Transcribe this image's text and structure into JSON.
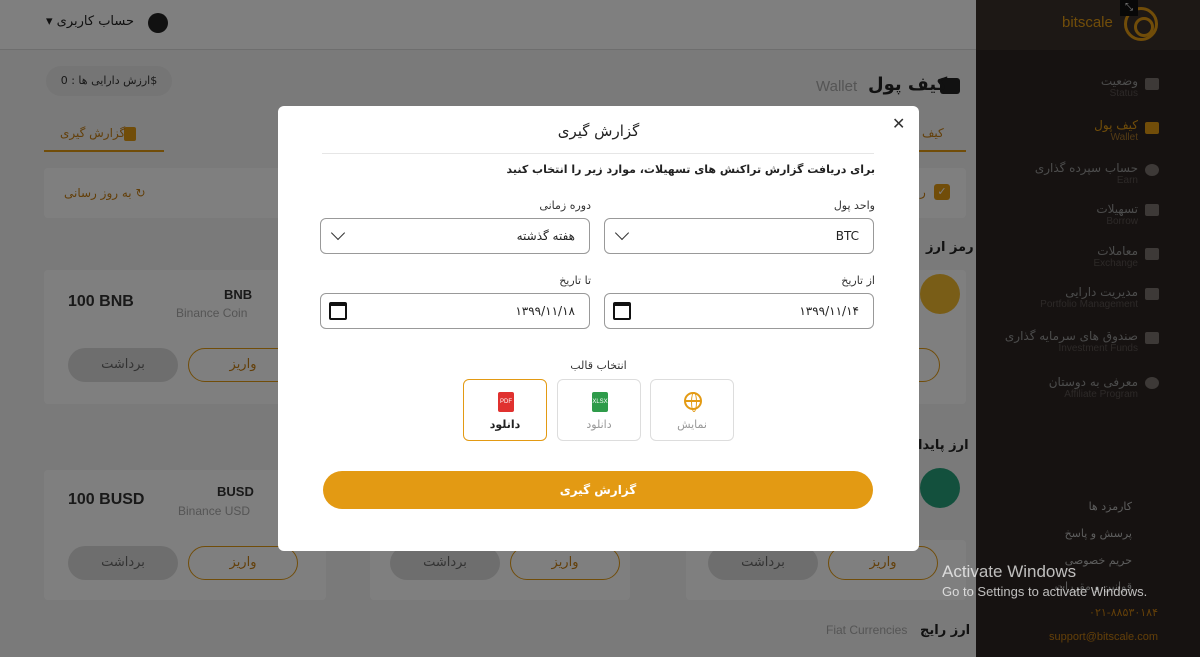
{
  "header": {
    "account_label": "حساب کاربری",
    "asset_value": "ارزش دارایی ها : 0$"
  },
  "wallet": {
    "title_fa": "کیف پول",
    "title_en": "Wallet",
    "tab_report": "گزارش گیری",
    "tab_wallet": "کیف",
    "refresh": "به روز رسانی",
    "check_label": "ر"
  },
  "sections": {
    "crypto": "رمز ارز",
    "stable": "ارز پایدا",
    "fiat_fa": "ارز رایج",
    "fiat_en": "Fiat Currencies"
  },
  "cards": [
    {
      "amount": "100 BNB",
      "symbol": "BNB",
      "name": "Binance Coin",
      "withdraw": "برداشت",
      "deposit": "واریز"
    },
    {
      "amount": "100 BUSD",
      "symbol": "BUSD",
      "name": "Binance USD",
      "withdraw": "برداشت",
      "deposit": "واریز"
    }
  ],
  "extra_buttons": {
    "withdraw": "برداشت",
    "deposit": "واریز"
  },
  "sidebar": {
    "brand": "bitscale",
    "items": [
      {
        "fa": "وضعیت",
        "en": "Status",
        "icon": "dashboard-icon"
      },
      {
        "fa": "کیف پول",
        "en": "Wallet",
        "icon": "wallet-icon"
      },
      {
        "fa": "حساب سپرده گذاری",
        "en": "Earn",
        "icon": "percent-icon"
      },
      {
        "fa": "تسهیلات",
        "en": "Borrow",
        "icon": "bag-icon"
      },
      {
        "fa": "معاملات",
        "en": "Exchange",
        "icon": "exchange-icon"
      },
      {
        "fa": "مدیریت دارایی",
        "en": "Portfolio Management",
        "icon": "briefcase-icon"
      },
      {
        "fa": "صندوق های سرمایه گذاری",
        "en": "Investment Funds",
        "icon": "chart-icon"
      },
      {
        "fa": "معرفی به دوستان",
        "en": "Affiliate Program",
        "icon": "users-icon"
      }
    ],
    "links": [
      "کارمزد ها",
      "پرسش و پاسخ",
      "حریم خصوصی",
      "قوانین و مقررات"
    ],
    "phone": "۰۲۱-۸۸۵۳۰۱۸۴",
    "email": "support@bitscale.com"
  },
  "modal": {
    "title": "گزارش گیری",
    "description": "برای دریافت گزارش تراکنش های تسهیلات، موارد زیر را انتخاب کنید",
    "unit_label": "واحد پول",
    "unit_value": "BTC",
    "period_label": "دوره زمانی",
    "period_value": "هفته گذشته",
    "from_label": "از تاریخ",
    "from_value": "۱۳۹۹/۱۱/۱۴",
    "to_label": "تا تاریخ",
    "to_value": "۱۳۹۹/۱۱/۱۸",
    "template_label": "انتخاب قالب",
    "templates": [
      {
        "caption": "نمایش",
        "icon": "globe-icon"
      },
      {
        "caption": "دانلود",
        "icon": "xlsx-file-icon",
        "badge": "XLSX"
      },
      {
        "caption": "دانلود",
        "icon": "pdf-file-icon",
        "badge": "PDF"
      }
    ],
    "submit": "گزارش گیری"
  },
  "os": {
    "activate_title": "Activate Windows",
    "activate_sub": "Go to Settings to activate Windows."
  },
  "colors": {
    "accent": "#e39a13",
    "sidebar": "#2c2522"
  }
}
